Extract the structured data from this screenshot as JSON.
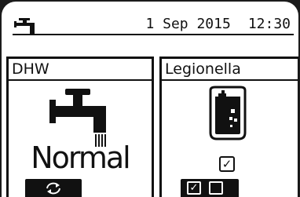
{
  "header": {
    "date": "1 Sep 2015",
    "time": "12:30",
    "icon": "tap-icon"
  },
  "panels": {
    "dhw": {
      "title": "DHW",
      "icon": "tap-icon",
      "mode": "Normal"
    },
    "legionella": {
      "title": "Legionella",
      "icon": "hot-water-tank-icon",
      "check_glyph": "✓"
    }
  },
  "softkeys": {
    "left": {
      "icon": "rotate-icon"
    },
    "right": {
      "box1_glyph": "✓",
      "box2_glyph": "",
      "icons": [
        "checked-box-icon",
        "empty-box-icon"
      ]
    }
  }
}
